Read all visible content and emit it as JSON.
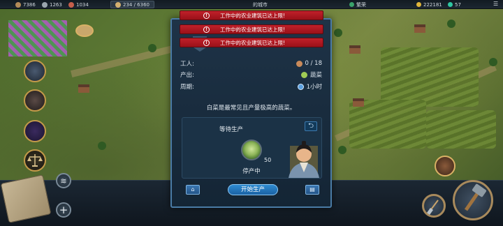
{
  "topbar": {
    "resources": [
      {
        "name": "wood-icon",
        "value": "7386",
        "color": "#b48b58"
      },
      {
        "name": "stone-icon",
        "value": "1263",
        "color": "#9aa5ad"
      },
      {
        "name": "meat-icon",
        "value": "1034",
        "color": "#c65e4b"
      },
      {
        "name": "population-icon",
        "value": "234 / 6360",
        "color": "#d4b070"
      }
    ],
    "city_fragment": "的城市",
    "status_fragment": "繁荣",
    "gold": "222181",
    "gems": "57"
  },
  "toasts": [
    {
      "text": "工作中的农业建筑已达上限!"
    },
    {
      "text": "工作中的农业建筑已达上限!"
    },
    {
      "text": "工作中的农业建筑已达上限!"
    }
  ],
  "dialog": {
    "rows": [
      {
        "label": "工人:",
        "value": "0 / 18",
        "icon": "worker-icon"
      },
      {
        "label": "产出:",
        "value": "蔬菜",
        "icon": "vegetable-icon"
      },
      {
        "label": "周期:",
        "value": "1小时",
        "icon": "clock-icon"
      }
    ],
    "description": "白菜是最常见且产量极高的蔬菜。",
    "production": {
      "title": "等待生产",
      "quantity": "50",
      "status": "停产中"
    },
    "start_button": "开始生产",
    "colors": {
      "accent": "#2f8bd1",
      "frame": "#4a7ba5",
      "toast": "#c0202a"
    }
  }
}
